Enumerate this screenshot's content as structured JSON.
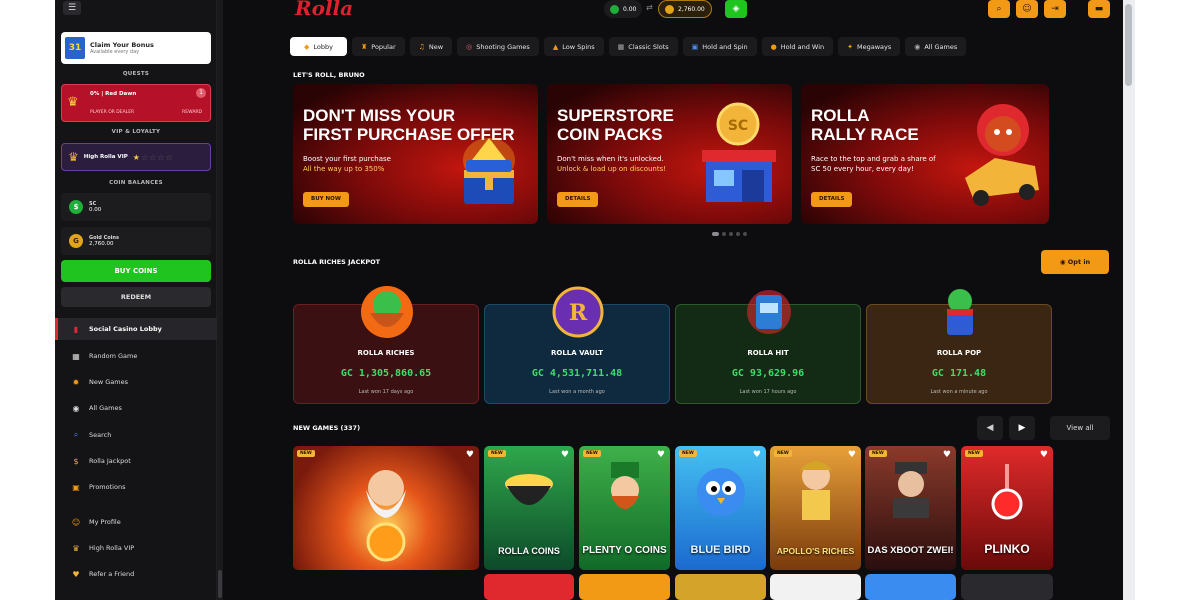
{
  "sidebar": {
    "menu_icon": "☰",
    "claim": {
      "title": "Claim Your Bonus",
      "subtitle": "Available every day"
    },
    "quests_label": "QUESTS",
    "quest": {
      "title": "0% | Red Dawn",
      "left": "PLAYER OR DEALER",
      "right": "REWARD",
      "count": "1"
    },
    "vip_label": "VIP & LOYALTY",
    "vip": {
      "label": "High Rolla VIP",
      "stars_on": "★",
      "stars_off": "☆☆☆☆"
    },
    "coin_label": "COIN BALANCES",
    "sc": {
      "name": "SC",
      "value": "0.00"
    },
    "gc": {
      "name": "Gold Coins",
      "value": "2,760.00"
    },
    "buy_label": "BUY COINS",
    "redeem_label": "REDEEM",
    "nav": [
      {
        "icon": "▮",
        "label": "Social Casino Lobby"
      },
      {
        "icon": "▦",
        "label": "Random Game"
      },
      {
        "icon": "✹",
        "label": "New Games"
      },
      {
        "icon": "◉",
        "label": "All Games"
      },
      {
        "icon": "⌕",
        "label": "Search"
      },
      {
        "icon": "$",
        "label": "Rolla Jackpot"
      },
      {
        "icon": "▣",
        "label": "Promotions"
      },
      {
        "icon": "☺",
        "label": "My Profile"
      },
      {
        "icon": "♛",
        "label": "High Rolla VIP"
      },
      {
        "icon": "♥",
        "label": "Refer a Friend"
      }
    ]
  },
  "header": {
    "logo": "Rolla",
    "sc_balance": "0.00",
    "gc_balance": "2,760.00",
    "swap": "⇄",
    "icons": {
      "search": "⌕",
      "profile": "☺",
      "logout": "⇥",
      "chat": "▬"
    }
  },
  "tabs": [
    {
      "icon": "◆",
      "label": "Lobby"
    },
    {
      "icon": "♜",
      "label": "Popular"
    },
    {
      "icon": "♫",
      "label": "New"
    },
    {
      "icon": "◎",
      "label": "Shooting Games"
    },
    {
      "icon": "▲",
      "label": "Low Spins"
    },
    {
      "icon": "▦",
      "label": "Classic Slots"
    },
    {
      "icon": "▣",
      "label": "Hold and Spin"
    },
    {
      "icon": "●",
      "label": "Hold and Win"
    },
    {
      "icon": "✦",
      "label": "Megaways"
    },
    {
      "icon": "◉",
      "label": "All Games"
    }
  ],
  "greeting": "LET'S ROLL, BRUNO",
  "banners": [
    {
      "headline1": "DON'T MISS YOUR",
      "headline2": "FIRST PURCHASE OFFER",
      "sub1": "Boost your first purchase",
      "sub2": "All the way up to 350%",
      "cta": "BUY NOW"
    },
    {
      "headline1": "SUPERSTORE",
      "headline2": "COIN PACKS",
      "sub1": "Don't miss when it's unlocked.",
      "sub2": "Unlock & load up on discounts!",
      "cta": "DETAILS"
    },
    {
      "headline1": "ROLLA",
      "headline2": "RALLY RACE",
      "sub1": "Race to the top and grab a share of",
      "sub2": "SC 50 every hour, every day!",
      "cta": "DETAILS"
    }
  ],
  "jackpot_section": {
    "title": "ROLLA RICHES JACKPOT",
    "opt_in": "Opt in"
  },
  "jackpots": [
    {
      "name": "ROLLA RICHES",
      "value": "GC 1,305,860.65",
      "time": "Last won 17 days ago"
    },
    {
      "name": "ROLLA VAULT",
      "value": "GC 4,531,711.48",
      "time": "Last won a month ago"
    },
    {
      "name": "ROLLA HIT",
      "value": "GC 93,629.96",
      "time": "Last won 17 hours ago"
    },
    {
      "name": "ROLLA POP",
      "value": "GC 171.48",
      "time": "Last won a minute ago"
    }
  ],
  "new_games": {
    "title": "NEW GAMES (337)",
    "prev": "◀",
    "next": "▶",
    "view_all": "View all"
  },
  "games": [
    {
      "title": "",
      "badge": "NEW"
    },
    {
      "title": "ROLLA COINS",
      "badge": "NEW"
    },
    {
      "title": "PLENTY O COINS",
      "badge": "NEW"
    },
    {
      "title": "BLUE BIRD",
      "badge": "NEW"
    },
    {
      "title": "APOLLO'S RICHES",
      "badge": "NEW"
    },
    {
      "title": "DAS XBOOT ZWEI!",
      "badge": "NEW"
    },
    {
      "title": "PLINKO",
      "badge": "NEW"
    }
  ]
}
